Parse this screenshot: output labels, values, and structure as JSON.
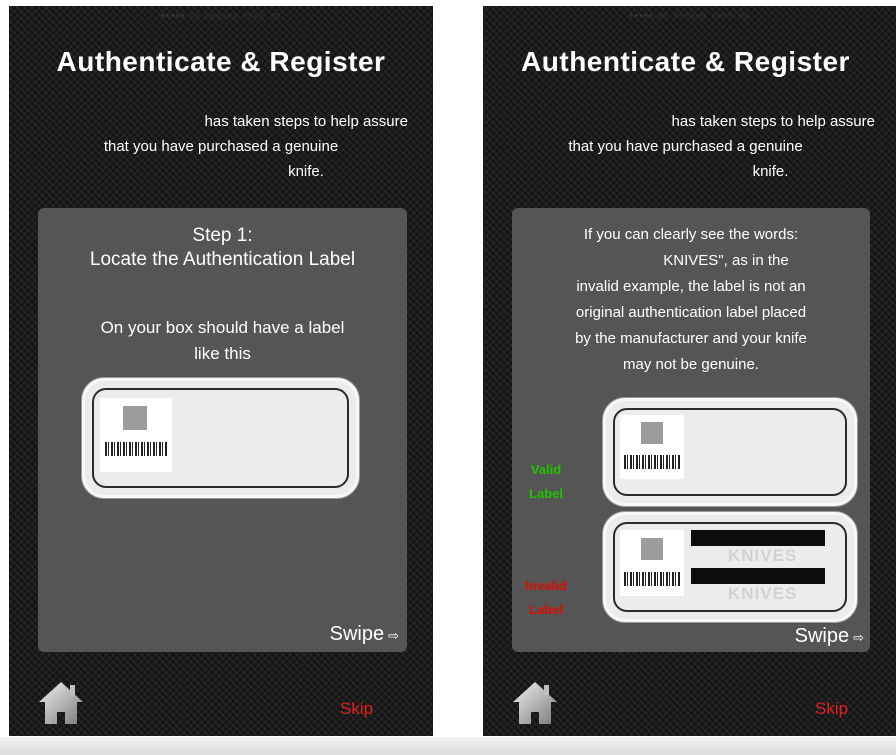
{
  "screens": [
    {
      "title": "Authenticate & Register",
      "intro": {
        "line1": "has taken steps to help assure",
        "line2": "that you have purchased a genuine",
        "line3": "knife."
      },
      "card": {
        "step_title": "Step 1:",
        "step_subtitle": "Locate the Authentication Label",
        "description_line1": "On your box should have a label",
        "description_line2": "like this",
        "swipe": "Swipe"
      },
      "skip": "Skip"
    },
    {
      "title": "Authenticate & Register",
      "intro": {
        "line1": "has taken steps to help assure",
        "line2": "that you have purchased a genuine",
        "line3": "knife."
      },
      "card": {
        "warning_lines": [
          "If you can clearly see the words:",
          "KNIVES\", as in the",
          "invalid example, the label is not an",
          "original authentication label placed",
          "by the manufacturer and your knife",
          "may not be genuine."
        ],
        "valid_label": [
          "Valid",
          "Label"
        ],
        "invalid_label": [
          "Invalid",
          "Label"
        ],
        "knives_word": "KNIVES",
        "swipe": "Swipe"
      },
      "skip": "Skip"
    }
  ],
  "colors": {
    "card_bg": "#555555",
    "skip": "#e0201c",
    "valid": "#22c400",
    "invalid": "#e00d00"
  },
  "icons": {
    "home": "home-icon",
    "swipe": "swipe-arrow-icon"
  }
}
